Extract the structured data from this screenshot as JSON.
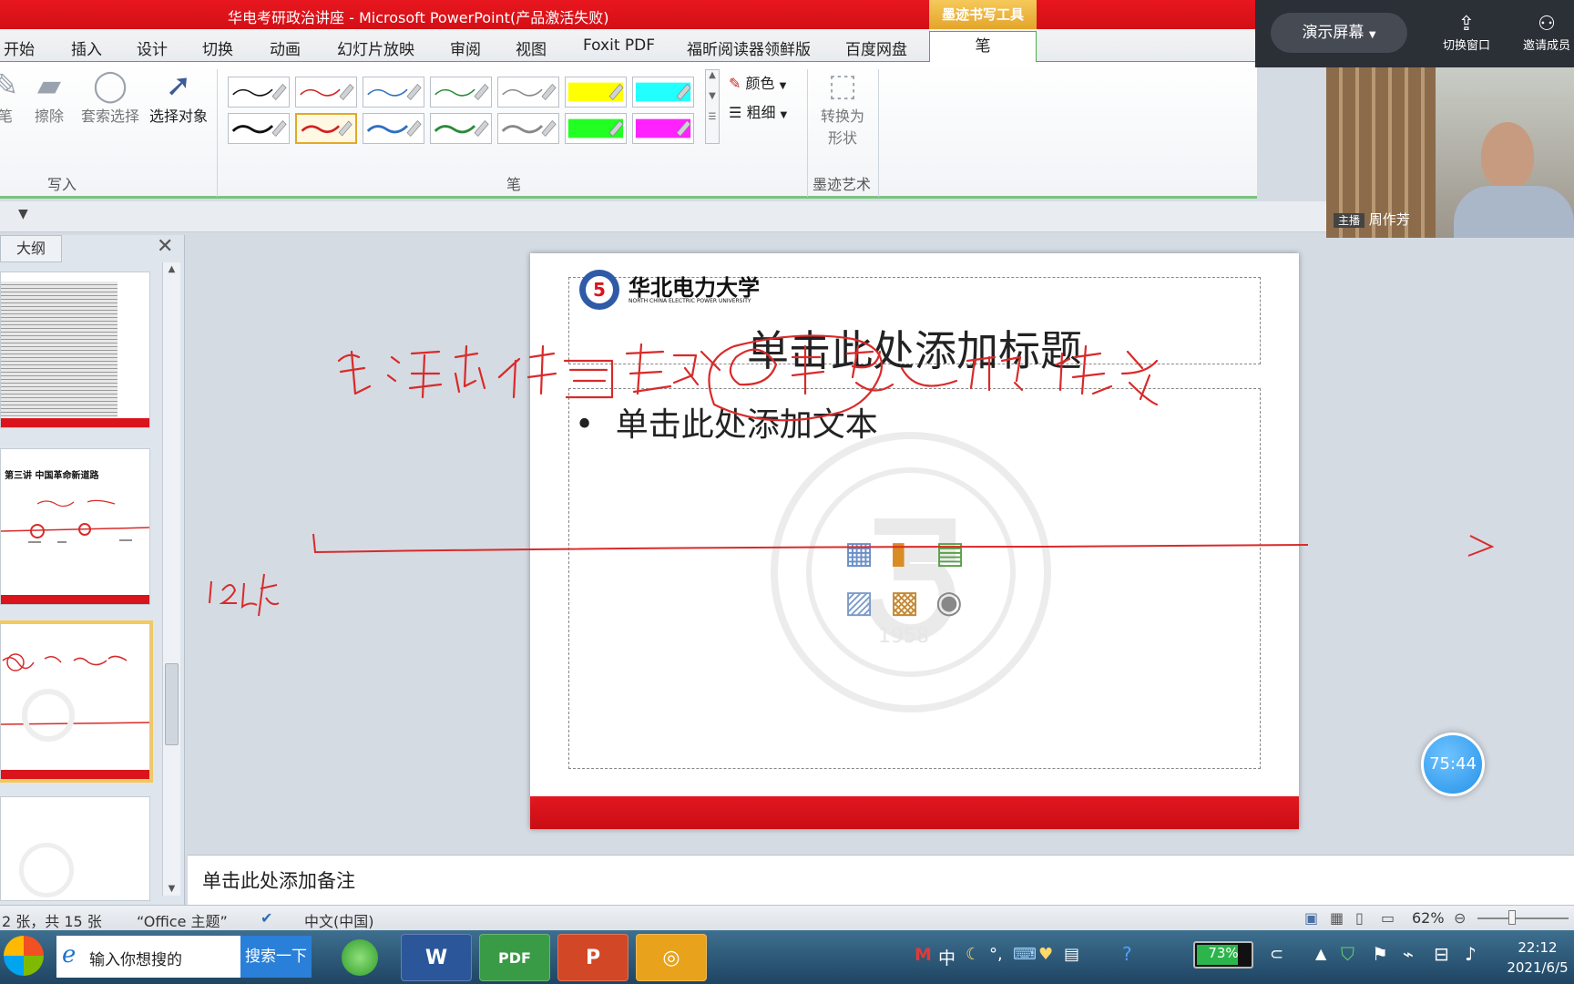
{
  "window": {
    "title": "华电考研政治讲座 - Microsoft PowerPoint(产品激活失败)",
    "context_tab": "墨迹书写工具"
  },
  "ribbon_tabs": [
    "开始",
    "插入",
    "设计",
    "切换",
    "动画",
    "幻灯片放映",
    "审阅",
    "视图",
    "Foxit PDF",
    "福昕阅读器领鲜版",
    "百度网盘"
  ],
  "active_tab": "笔",
  "ribbon": {
    "write_group": {
      "label": "写入",
      "pen": "笔",
      "erase": "擦除",
      "lasso": "套索选择",
      "select_objects": "选择对象"
    },
    "pens_group": {
      "label": "笔",
      "color": "颜色",
      "weight": "粗细",
      "swatch_colors_row1": [
        "#111111",
        "#d22020",
        "#2f6fc0",
        "#2a8a3a",
        "#888888",
        "#ffff00",
        "#22ffff"
      ],
      "swatch_colors_row2": [
        "#111111",
        "#d22020",
        "#2f6fc0",
        "#2a8a3a",
        "#888888",
        "#22ff22",
        "#ff22ff"
      ]
    },
    "ink_art_group": {
      "label": "墨迹艺术",
      "convert_line1": "转换为",
      "convert_line2": "形状"
    }
  },
  "left_panel": {
    "outline_tab": "大纲",
    "thumb2_text": "第三讲 中国革命新道路"
  },
  "slide": {
    "logo_cn": "华北电力大学",
    "logo_en": "NORTH CHINA ELECTRIC POWER UNIVERSITY",
    "title_placeholder": "单击此处添加标题",
    "body_bullet": "•",
    "body_placeholder": "单击此处添加文本",
    "watermark_text": "NORTH CHINA ELECTRIC POWER UNIVERSITY",
    "watermark_year": "1958"
  },
  "notes_placeholder": "单击此处添加备注",
  "status": {
    "slide_count": "2 张，共 15 张",
    "theme": "“Office 主题”",
    "language": "中文(中国)",
    "zoom": "62%"
  },
  "taskbar": {
    "search_placeholder": "输入你想搜的",
    "search_button": "搜索一下",
    "battery": "73%",
    "time": "22:12",
    "date": "2021/6/5",
    "ime": "中"
  },
  "meeting": {
    "present_button": "演示屏幕",
    "switch_window": "切换窗口",
    "invite": "邀请成员",
    "host_badge": "主播",
    "host_name": "周作芳",
    "timer": "75:44"
  },
  "colors": {
    "title_bar": "#d9141c",
    "accent_green": "#4caf50",
    "ink_red": "#d92a2a"
  }
}
